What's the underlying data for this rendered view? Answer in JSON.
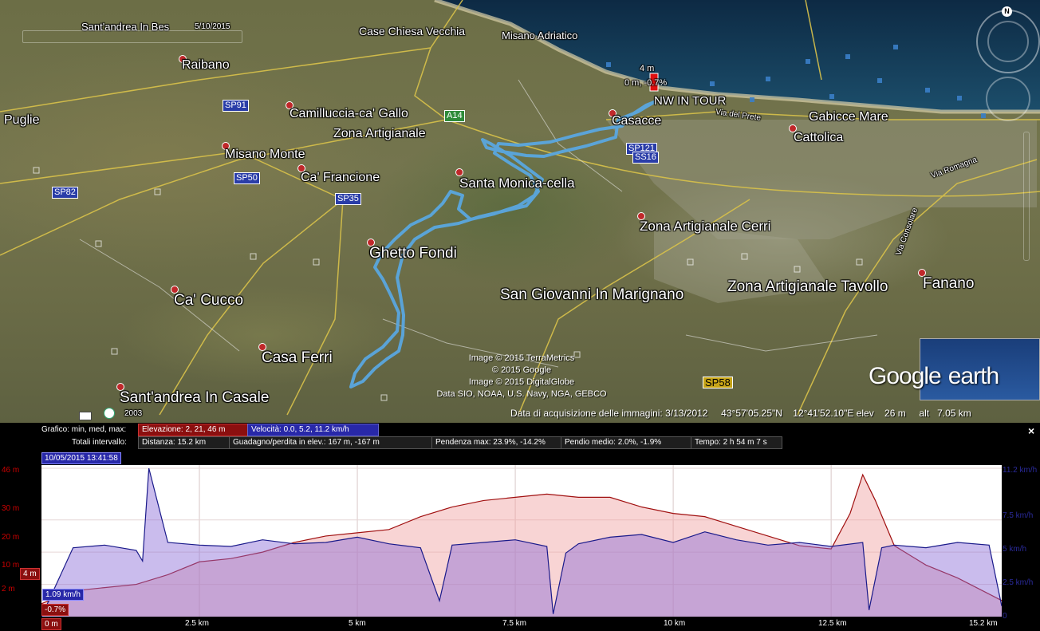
{
  "map": {
    "labels_lg": [
      {
        "name": "ghetto-fondi-label",
        "text": "Ghetto Fondi"
      },
      {
        "name": "santa-monica-label",
        "text": "Santa Monica-cella"
      },
      {
        "name": "zona-cerri-label",
        "text": "Zona Artigianale Cerri"
      },
      {
        "name": "san-giovanni-label",
        "text": "San Giovanni In Marignano"
      },
      {
        "name": "zona-tavollo-label",
        "text": "Zona Artigianale Tavollo"
      },
      {
        "name": "ca-cucco-label",
        "text": "Ca' Cucco"
      },
      {
        "name": "casa-ferri-label",
        "text": "Casa Ferri"
      },
      {
        "name": "santandrea-casale-label",
        "text": "Sant'andrea In Casale"
      },
      {
        "name": "fanano-label",
        "text": "Fanano"
      }
    ],
    "labels_md": [
      {
        "name": "raibano-label",
        "text": "Raibano"
      },
      {
        "name": "puglie-label",
        "text": "Puglie"
      },
      {
        "name": "camillucia-label",
        "text": "Camilluccia-ca' Gallo"
      },
      {
        "name": "zona-artigianale-label",
        "text": "Zona Artigianale"
      },
      {
        "name": "misano-monte-label",
        "text": "Misano Monte"
      },
      {
        "name": "ca-francione-label",
        "text": "Ca' Francione"
      },
      {
        "name": "casacce-label",
        "text": "Casacce"
      },
      {
        "name": "cattolica-label",
        "text": "Cattolica"
      },
      {
        "name": "gabicce-label",
        "text": "Gabicce Mare"
      },
      {
        "name": "nw-in-tour-label",
        "text": "NW IN TOUR"
      }
    ],
    "labels_sm": [
      {
        "name": "case-chiesa-label",
        "text": "Case Chiesa Vecchia"
      },
      {
        "name": "misano-adriatico-label",
        "text": "Misano Adriatico"
      },
      {
        "name": "santandrea-bes-label",
        "text": "Sant'andrea In Bes"
      }
    ],
    "shields": [
      {
        "name": "sp91-shield",
        "text": "SP91"
      },
      {
        "name": "sp50-shield",
        "text": "SP50"
      },
      {
        "name": "sp82-shield",
        "text": "SP82"
      },
      {
        "name": "sp35-shield",
        "text": "SP35"
      },
      {
        "name": "sp121-shield",
        "text": "SP121"
      },
      {
        "name": "ss16-shield",
        "text": "SS16"
      },
      {
        "name": "a14-shield",
        "text": "A14"
      },
      {
        "name": "s58-shield",
        "text": "SP58"
      }
    ],
    "date_stamp": "5/10/2015",
    "marker_elev": "4 m",
    "marker_stats": "0 m, -0.7%",
    "year_badge": "2003",
    "road_labels": [
      "Via del Prete",
      "Via Romagna",
      "Via Consolare"
    ],
    "credits": [
      "Image © 2015 TerraMetrics",
      "© 2015 Google",
      "Image © 2015 DigitalGlobe",
      "Data SIO, NOAA, U.S. Navy, NGA, GEBCO"
    ],
    "status": {
      "acq_label": "Data di acquisizione delle immagini:",
      "acq_date": "3/13/2012",
      "lat": "43°57'05.25\"N",
      "lon": "12°41'52.10\"E",
      "elev_label": "elev",
      "elev_value": "26 m",
      "alt_label": "alt",
      "alt_value": "7.05 km"
    },
    "compass_n": "N",
    "logo_google": "Google",
    "logo_earth": "earth"
  },
  "profile": {
    "row1_label": "Grafico: min, med, max:",
    "elevation_stat": "Elevazione: 2, 21, 46 m",
    "speed_stat": "Velocità: 0.0, 5.2, 11.2 km/h",
    "row2_label": "Totali intervallo:",
    "distance": "Distanza: 15.2 km",
    "gain_loss": "Guadagno/perdita in elev.: 167 m, -167 m",
    "max_slope": "Pendenza max: 23.9%, -14.2%",
    "avg_slope": "Pendio medio: 2.0%, -1.9%",
    "time": "Tempo: 2 h 54 m 7 s",
    "close": "×",
    "timestamp": "10/05/2015 13:41:58",
    "cursor_elev": "4 m",
    "cursor_speed": "1.09 km/h",
    "cursor_slope": "-0.7%",
    "cursor_dist": "0 m"
  },
  "chart_data": {
    "type": "area",
    "title": "",
    "xlabel": "",
    "x_ticks": [
      "0 m",
      "2.5 km",
      "5 km",
      "7.5 km",
      "10 km",
      "12.5 km",
      "15.2 km"
    ],
    "y_left_ticks": [
      "46 m",
      "30 m",
      "20 m",
      "10 m",
      "2 m"
    ],
    "y_right_ticks": [
      "11.2 km/h",
      "7.5 km/h",
      "5 km/h",
      "2.5 km/h",
      "0"
    ],
    "xlim": [
      0,
      15.2
    ],
    "ylim_left": [
      0,
      46
    ],
    "ylim_right": [
      0,
      11.2
    ],
    "series": [
      {
        "name": "Elevazione",
        "unit": "m",
        "color": "#a01010",
        "x": [
          0,
          0.5,
          1,
          1.5,
          2,
          2.5,
          3,
          3.5,
          4,
          4.5,
          5,
          5.5,
          6,
          6.5,
          7,
          7.5,
          8,
          8.5,
          9,
          9.5,
          10,
          10.5,
          11,
          11.5,
          12,
          12.5,
          12.8,
          13,
          13.2,
          13.5,
          14,
          14.5,
          15,
          15.2
        ],
        "values": [
          4,
          8,
          9,
          10,
          13,
          17,
          18,
          20,
          23,
          25,
          26,
          27,
          31,
          34,
          36,
          37,
          38,
          37,
          37,
          34,
          32,
          31,
          28,
          25,
          22,
          21,
          32,
          44,
          36,
          22,
          16,
          12,
          7,
          5
        ]
      },
      {
        "name": "Velocità",
        "unit": "km/h",
        "color": "#1a1a8a",
        "x": [
          0,
          0.5,
          1,
          1.5,
          1.6,
          1.7,
          2,
          2.5,
          3,
          3.5,
          4,
          4.5,
          5,
          5.5,
          6,
          6.3,
          6.5,
          7,
          7.5,
          8,
          8.1,
          8.3,
          8.5,
          9,
          9.5,
          10,
          10.5,
          11,
          11.5,
          12,
          12.5,
          13,
          13.1,
          13.3,
          13.5,
          14,
          14.5,
          15,
          15.2
        ],
        "values": [
          0,
          5.2,
          5.4,
          5.0,
          4.2,
          11.2,
          5.6,
          5.4,
          5.3,
          5.8,
          5.5,
          5.6,
          6.0,
          5.5,
          5.2,
          1.2,
          5.4,
          5.6,
          5.8,
          5.3,
          0.2,
          4.8,
          5.5,
          6.0,
          6.2,
          5.6,
          6.4,
          5.8,
          5.4,
          5.6,
          5.3,
          5.6,
          0.5,
          5.2,
          5.4,
          5.2,
          5.6,
          5.4,
          0.8
        ]
      }
    ]
  }
}
